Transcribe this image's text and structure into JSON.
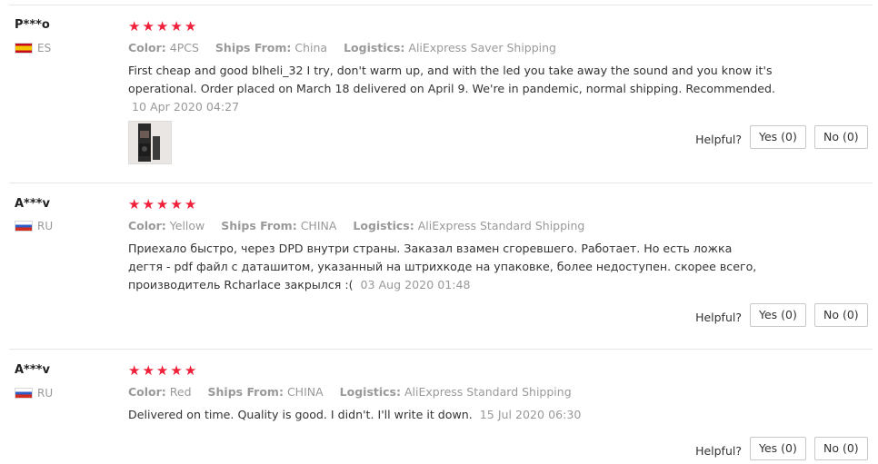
{
  "reviews": [
    {
      "user": "P***o",
      "country_code": "ES",
      "rating": 5,
      "color_label": "Color:",
      "color_value": "4PCS",
      "ships_label": "Ships From:",
      "ships_value": "China",
      "logistics_label": "Logistics:",
      "logistics_value": "AliExpress Saver Shipping",
      "text": "First cheap and good blheli_32 I try, don't warm up, and with the led you take away the sound and you know it's operational. Order placed on March 18 delivered on April 9. We're in pandemic, normal shipping. Recommended.",
      "date": "10 Apr 2020 04:27",
      "helpful_label": "Helpful?",
      "yes_label": "Yes (0)",
      "no_label": "No (0)"
    },
    {
      "user": "A***v",
      "country_code": "RU",
      "rating": 5,
      "color_label": "Color:",
      "color_value": "Yellow",
      "ships_label": "Ships From:",
      "ships_value": "CHINA",
      "logistics_label": "Logistics:",
      "logistics_value": "AliExpress Standard Shipping",
      "text": "Приехало быстро, через DPD внутри страны. Заказал взамен сгоревшего. Работает. Но есть ложка дегтя - pdf файл с даташитом, указанный на штрихкоде на упаковке, более недоступен. скорее всего, производитель Rcharlace закрылся :(",
      "date": "03 Aug 2020 01:48",
      "helpful_label": "Helpful?",
      "yes_label": "Yes (0)",
      "no_label": "No (0)"
    },
    {
      "user": "A***v",
      "country_code": "RU",
      "rating": 5,
      "color_label": "Color:",
      "color_value": "Red",
      "ships_label": "Ships From:",
      "ships_value": "CHINA",
      "logistics_label": "Logistics:",
      "logistics_value": "AliExpress Standard Shipping",
      "text": "Delivered on time. Quality is good. I didn't. I'll write it down.",
      "date": "15 Jul 2020 06:30",
      "helpful_label": "Helpful?",
      "yes_label": "Yes (0)",
      "no_label": "No (0)"
    }
  ],
  "colors": {
    "star": "#f0203a",
    "muted": "#999999",
    "text": "#333333"
  }
}
